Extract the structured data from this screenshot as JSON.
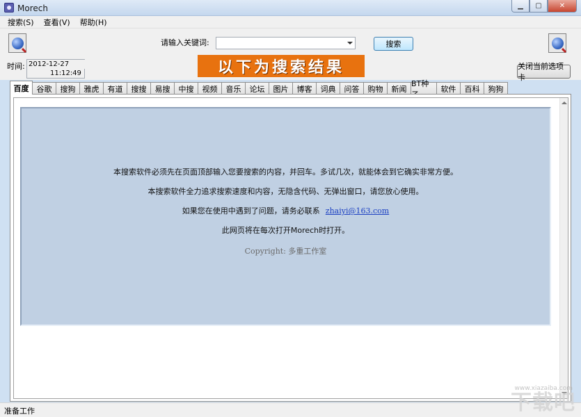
{
  "window": {
    "title": "Morech"
  },
  "menu": [
    {
      "label": "搜索(S)"
    },
    {
      "label": "查看(V)"
    },
    {
      "label": "帮助(H)"
    }
  ],
  "search": {
    "keyword_label": "请输入关键词:",
    "keyword_value": "",
    "button_label": "搜索"
  },
  "time": {
    "label": "时间:",
    "date": "2012-12-27",
    "clock": "11:12:49"
  },
  "banner_text": "以下为搜索结果",
  "close_tab_label": "关闭当前选项卡",
  "tabs": [
    {
      "label": "百度",
      "active": true
    },
    {
      "label": "谷歌"
    },
    {
      "label": "搜狗"
    },
    {
      "label": "雅虎"
    },
    {
      "label": "有道"
    },
    {
      "label": "搜搜"
    },
    {
      "label": "易搜"
    },
    {
      "label": "中搜"
    },
    {
      "label": "视频"
    },
    {
      "label": "音乐"
    },
    {
      "label": "论坛"
    },
    {
      "label": "图片"
    },
    {
      "label": "博客"
    },
    {
      "label": "词典"
    },
    {
      "label": "问答"
    },
    {
      "label": "购物"
    },
    {
      "label": "新闻"
    },
    {
      "label": "BT种子"
    },
    {
      "label": "软件"
    },
    {
      "label": "百科"
    },
    {
      "label": "狗狗"
    }
  ],
  "content": {
    "line1": "本搜索软件必须先在页面顶部输入您要搜索的内容，并回车。多试几次，就能体会到它确实非常方便。",
    "line2": "本搜索软件全力追求搜索速度和内容，无隐含代码、无弹出窗口，请您放心使用。",
    "line3_text": "如果您在使用中遇到了问题，请务必联系",
    "line3_email": "zhaiyi@163.com",
    "line4": "此网页将在每次打开Morech时打开。",
    "copyright": "Copyright:   多重工作室"
  },
  "status": {
    "text": "准备工作"
  },
  "watermark": {
    "text": "下载吧",
    "url": "www.xiazaiba.com"
  },
  "colors": {
    "banner_bg": "#e8720f",
    "content_bg": "#c0d0e3",
    "link": "#1a3fc2"
  },
  "icons": {
    "left_tool": "globe-search-icon",
    "right_tool": "globe-search-icon"
  }
}
